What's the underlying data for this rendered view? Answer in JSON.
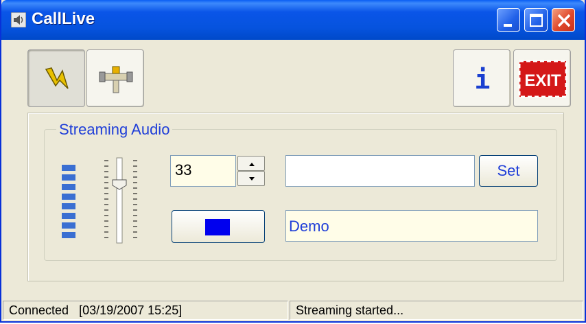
{
  "window": {
    "title": "CallLive",
    "app_icon": "speaker-icon",
    "controls": {
      "minimize": "minimize-icon",
      "maximize": "maximize-icon",
      "close": "close-icon"
    }
  },
  "toolbar": {
    "connect": {
      "icon": "lightning-icon",
      "pressed": true
    },
    "settings": {
      "icon": "t-connector-icon"
    },
    "info": {
      "icon": "info-icon",
      "label": "i"
    },
    "exit": {
      "icon": "exit-sign-icon",
      "label": "EXIT"
    }
  },
  "streaming": {
    "title": "Streaming Audio",
    "level_segments": 8,
    "volume_value": "33",
    "text_field_value": "",
    "set_label": "Set",
    "stop_icon": "stop-icon",
    "name_value": "Demo"
  },
  "status": {
    "left": "Connected   [03/19/2007 15:25]",
    "right": "Streaming started..."
  },
  "colors": {
    "titlebar": "#0653de",
    "face": "#ece9d8",
    "label_blue": "#1f3ed8",
    "stop_blue": "#0000ee",
    "meter_blue": "#3a6fd2"
  }
}
